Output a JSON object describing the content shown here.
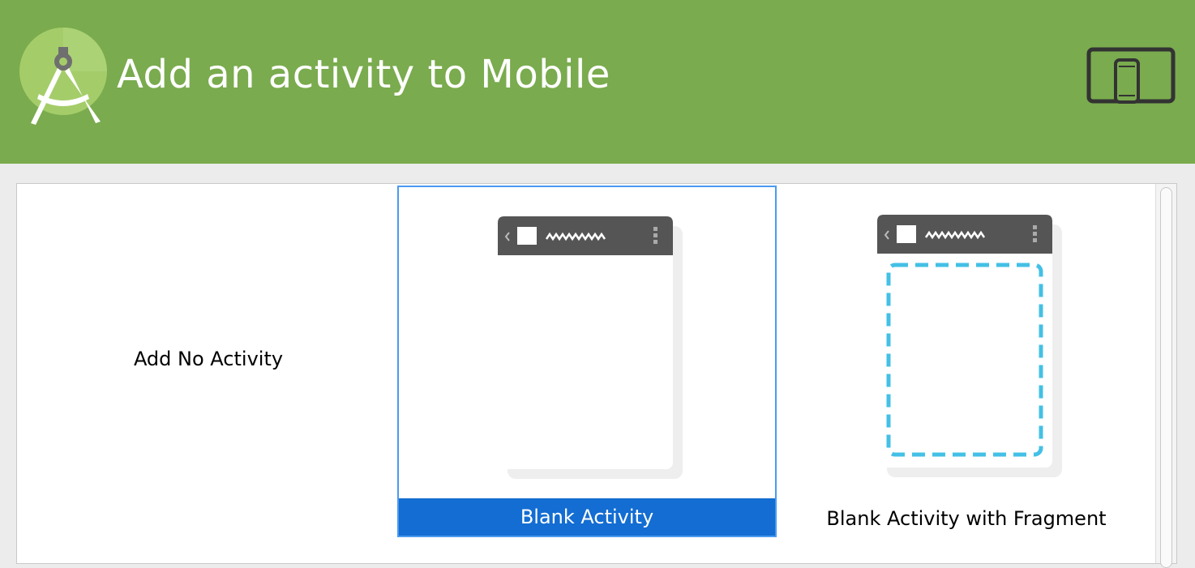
{
  "header": {
    "title": "Add an activity to Mobile",
    "background_color": "#7aab4e",
    "logo_icon": "android-studio-logo-icon",
    "device_icon": "phone-tablet-icon"
  },
  "gallery": {
    "tiles": [
      {
        "label": "Add No Activity",
        "selected": false
      },
      {
        "label": "Blank Activity",
        "selected": true,
        "preview_icon": "blank-activity-preview-icon"
      },
      {
        "label": "Blank Activity with Fragment",
        "selected": false,
        "preview_icon": "fragment-activity-preview-icon"
      }
    ],
    "selection_color": "#136dd2",
    "fragment_outline_color": "#44c0e6"
  }
}
